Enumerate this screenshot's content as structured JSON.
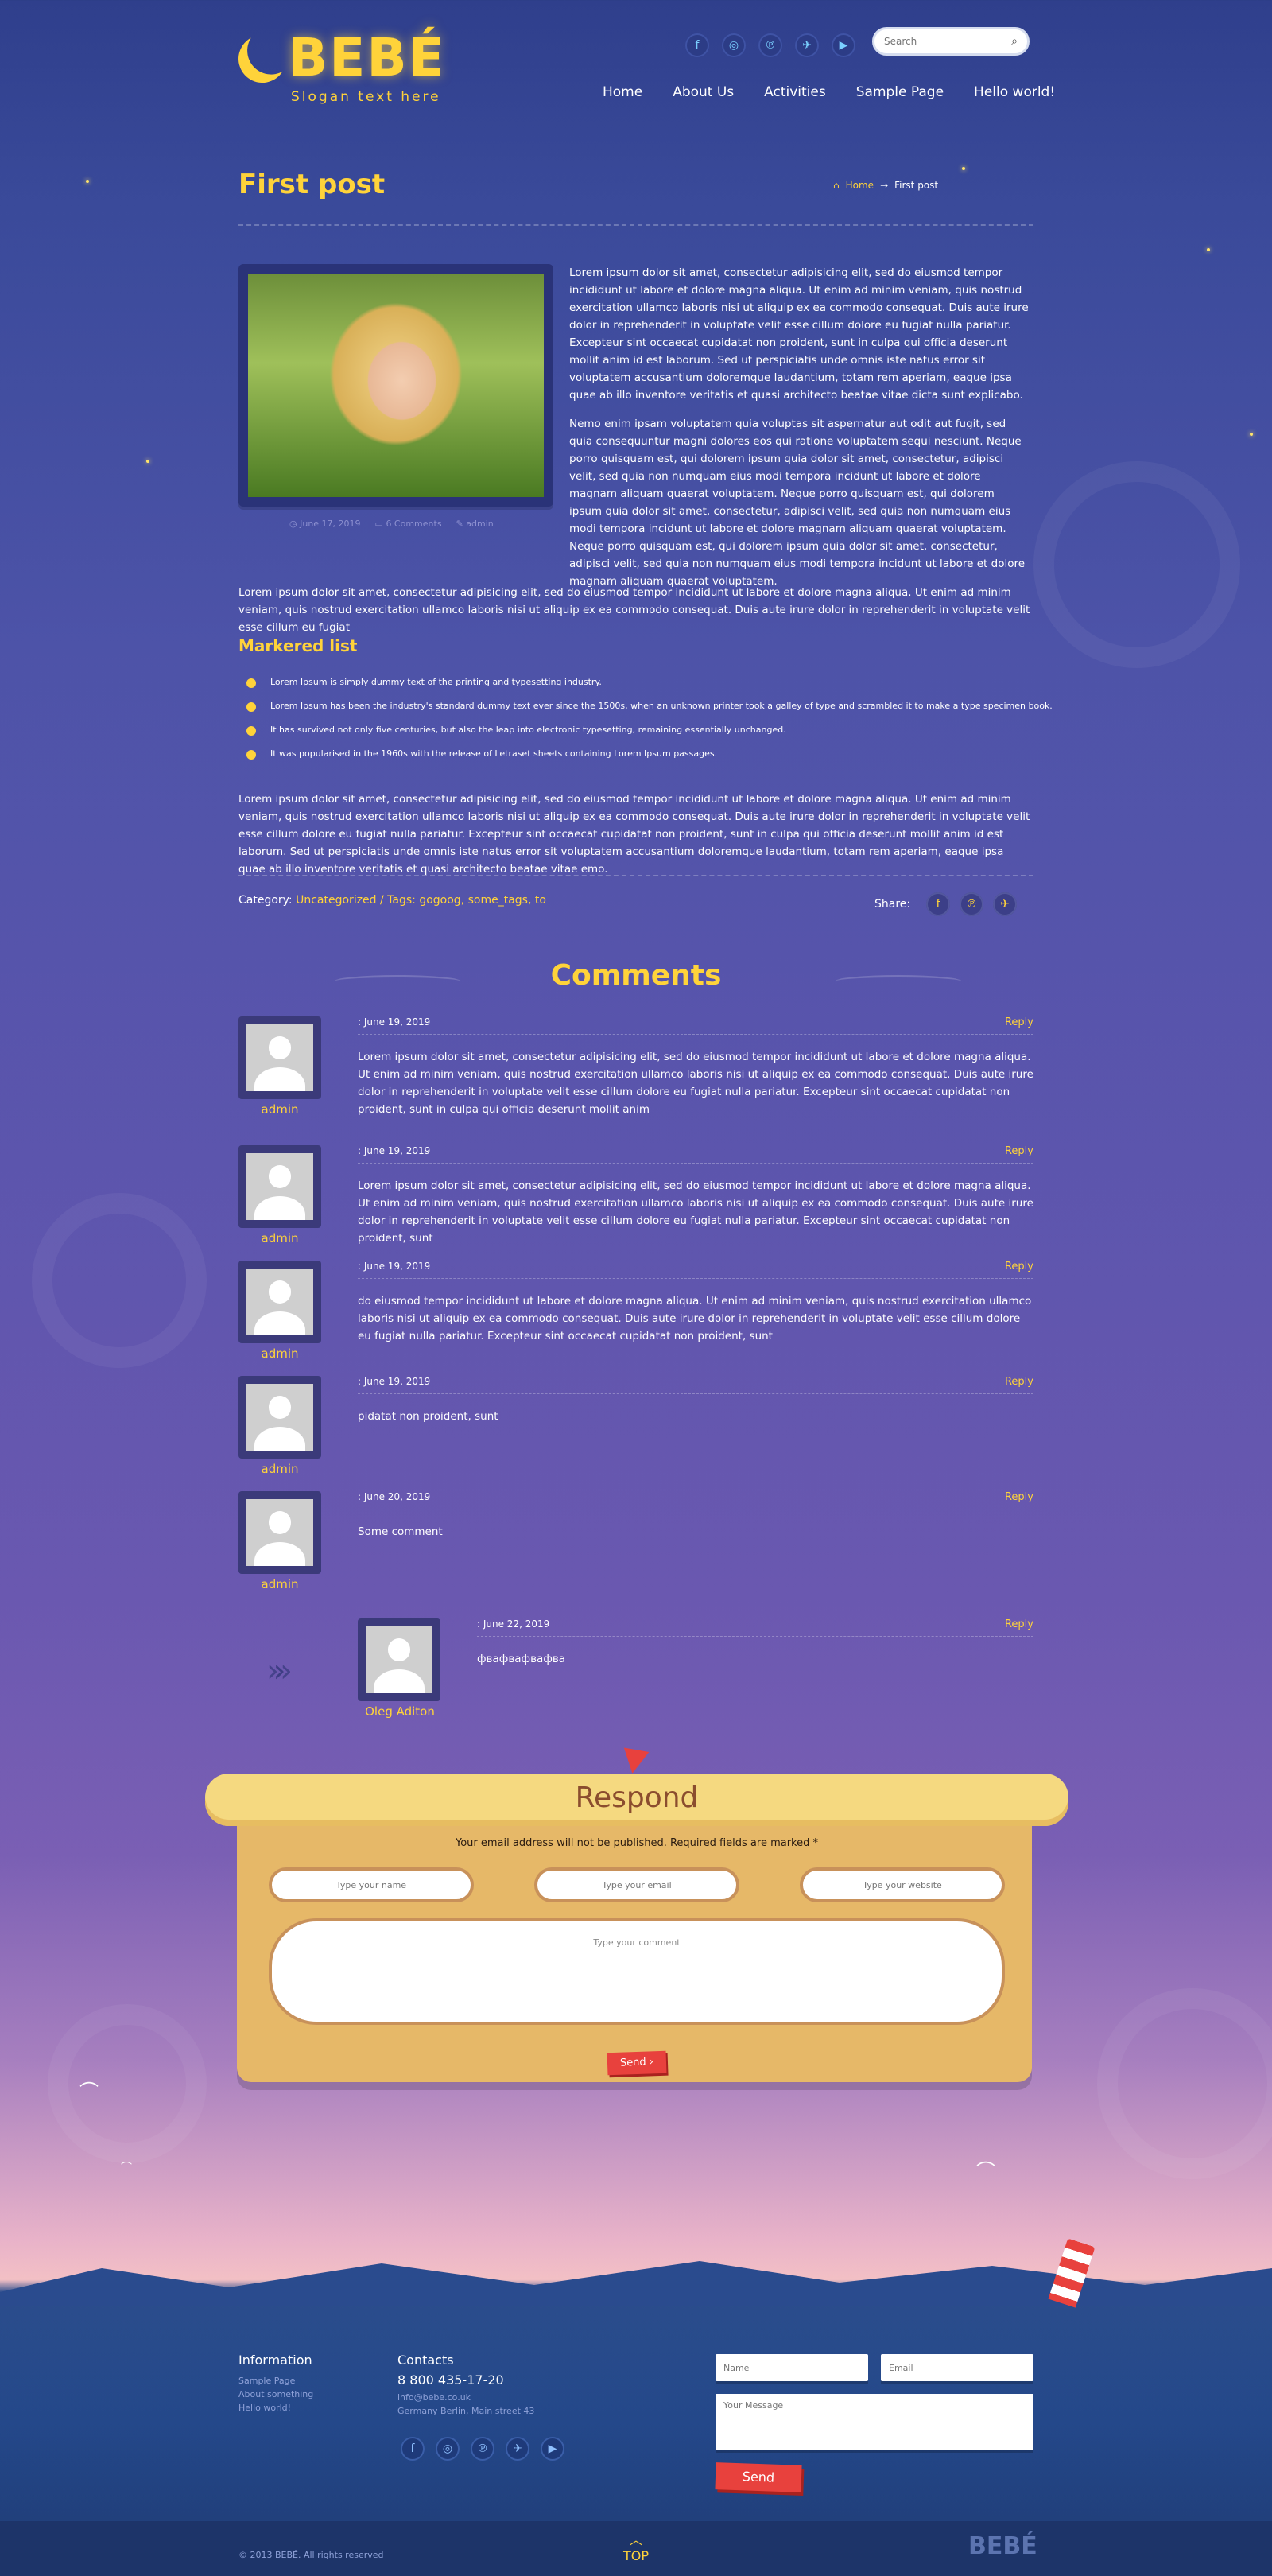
{
  "header": {
    "logo_text": "BEBÉ",
    "slogan": "Slogan text here",
    "social": [
      {
        "icon": "facebook-icon",
        "glyph": "f"
      },
      {
        "icon": "instagram-icon",
        "glyph": "◎"
      },
      {
        "icon": "pinterest-icon",
        "glyph": "℗"
      },
      {
        "icon": "twitter-icon",
        "glyph": "✈"
      },
      {
        "icon": "youtube-icon",
        "glyph": "▶"
      }
    ],
    "search_placeholder": "Search",
    "nav": [
      "Home",
      "About Us",
      "Activities",
      "Sample Page",
      "Hello world!"
    ]
  },
  "page": {
    "title": "First post",
    "breadcrumb_home": "Home",
    "breadcrumb_sep": "→",
    "breadcrumb_current": "First post"
  },
  "post": {
    "meta_date": "June 17, 2019",
    "meta_comments": "6 Comments",
    "meta_author": "admin",
    "p1": "Lorem ipsum dolor sit amet, consectetur adipisicing elit, sed do eiusmod tempor incididunt ut labore et dolore magna aliqua. Ut enim ad minim veniam, quis nostrud exercitation ullamco laboris nisi ut aliquip ex ea commodo consequat. Duis aute irure dolor in reprehenderit in voluptate velit esse cillum dolore eu fugiat nulla pariatur. Excepteur sint occaecat cupidatat non proident, sunt in culpa qui officia deserunt mollit anim id est laborum. Sed ut perspiciatis unde omnis iste natus error sit voluptatem accusantium doloremque laudantium, totam rem aperiam, eaque ipsa quae ab illo inventore veritatis et quasi architecto beatae vitae dicta sunt explicabo.",
    "p2": "Nemo enim ipsam voluptatem quia voluptas sit aspernatur aut odit aut fugit, sed quia consequuntur magni dolores eos qui ratione voluptatem sequi nesciunt. Neque porro quisquam est, qui dolorem ipsum quia dolor sit amet, consectetur, adipisci velit, sed quia non numquam eius modi tempora incidunt ut labore et dolore magnam aliquam quaerat voluptatem. Neque porro quisquam est, qui dolorem ipsum quia dolor sit amet, consectetur, adipisci velit, sed quia non numquam eius modi tempora incidunt ut labore et dolore magnam aliquam quaerat voluptatem. Neque porro quisquam est, qui dolorem ipsum quia dolor sit amet, consectetur, adipisci velit, sed quia non numquam eius modi tempora incidunt ut labore et dolore magnam aliquam quaerat voluptatem.",
    "p3": "Lorem ipsum dolor sit amet, consectetur adipisicing elit, sed do eiusmod tempor incididunt ut labore et dolore magna aliqua. Ut enim ad minim veniam, quis nostrud exercitation ullamco laboris nisi ut aliquip ex ea commodo consequat. Duis aute irure dolor in reprehenderit in voluptate velit esse cillum eu fugiat",
    "list_title": "Markered list",
    "list": [
      "Lorem Ipsum is simply dummy text of the printing and typesetting industry.",
      "Lorem Ipsum has been the industry's standard dummy text ever since the 1500s, when an unknown printer took a galley of type and scrambled it to make a type specimen book.",
      "It has survived not only five centuries, but also the leap into electronic typesetting, remaining essentially unchanged.",
      "It was popularised in the 1960s with the release of Letraset sheets containing Lorem Ipsum passages."
    ],
    "p4": "Lorem ipsum dolor sit amet, consectetur adipisicing elit, sed do eiusmod tempor incididunt ut labore et dolore magna aliqua. Ut enim ad minim veniam, quis nostrud exercitation ullamco laboris nisi ut aliquip ex ea commodo consequat. Duis aute irure dolor in reprehenderit in voluptate velit esse cillum dolore eu fugiat nulla pariatur. Excepteur sint occaecat cupidatat non proident, sunt in culpa qui officia deserunt mollit anim id est laborum. Sed ut perspiciatis unde omnis iste natus error sit voluptatem accusantium doloremque laudantium, totam rem aperiam, eaque ipsa quae ab illo inventore veritatis et quasi architecto beatae vitae emo.",
    "category_label": "Category:",
    "category_value": "Uncategorized / Tags: gogoog, some_tags, to",
    "share_label": "Share:",
    "share_icons": [
      {
        "icon": "facebook-icon",
        "glyph": "f"
      },
      {
        "icon": "pinterest-icon",
        "glyph": "℗"
      },
      {
        "icon": "twitter-icon",
        "glyph": "✈"
      }
    ]
  },
  "comments": {
    "title": "Comments",
    "reply_label": "Reply",
    "items": [
      {
        "author": "admin",
        "date": ": June 19, 2019",
        "text": "Lorem ipsum dolor sit amet, consectetur adipisicing elit, sed do eiusmod tempor incididunt ut labore et dolore magna aliqua. Ut enim ad minim veniam, quis nostrud exercitation ullamco laboris nisi ut aliquip ex ea commodo consequat. Duis aute irure dolor in reprehenderit in voluptate velit esse cillum dolore eu fugiat nulla pariatur. Excepteur sint occaecat cupidatat non proident, sunt in culpa qui officia deserunt mollit anim"
      },
      {
        "author": "admin",
        "date": ": June 19, 2019",
        "text": "Lorem ipsum dolor sit amet, consectetur adipisicing elit, sed do eiusmod tempor incididunt ut labore et dolore magna aliqua. Ut enim ad minim veniam, quis nostrud exercitation ullamco laboris nisi ut aliquip ex ea commodo consequat. Duis aute irure dolor in reprehenderit in voluptate velit esse cillum dolore eu fugiat nulla pariatur. Excepteur sint occaecat cupidatat non proident, sunt"
      },
      {
        "author": "admin",
        "date": ": June 19, 2019",
        "text": "do eiusmod tempor incididunt ut labore et dolore magna aliqua. Ut enim ad minim veniam, quis nostrud exercitation ullamco laboris nisi ut aliquip ex ea commodo consequat. Duis aute irure dolor in reprehenderit in voluptate velit esse cillum dolore eu fugiat nulla pariatur. Excepteur sint occaecat cupidatat non proident, sunt"
      },
      {
        "author": "admin",
        "date": ": June 19, 2019",
        "text": "pidatat non proident, sunt"
      },
      {
        "author": "admin",
        "date": ": June 20, 2019",
        "text": "Some comment"
      },
      {
        "author": "Oleg Aditon",
        "date": ": June 22, 2019",
        "text": "фвафвафвафва"
      }
    ]
  },
  "respond": {
    "title": "Respond",
    "note": "Your email address will not be published. Required fields are marked *",
    "name_placeholder": "Type your name",
    "email_placeholder": "Type your email",
    "website_placeholder": "Type your website",
    "comment_placeholder": "Type your comment",
    "send_label": "Send ›"
  },
  "footer": {
    "info_title": "Information",
    "info_links": [
      "Sample Page",
      "About something",
      "Hello world!"
    ],
    "contacts_title": "Contacts",
    "phone": "8 800 435-17-20",
    "email": "info@bebe.co.uk",
    "address": "Germany Berlin, Main street 43",
    "social": [
      {
        "icon": "facebook-icon",
        "glyph": "f"
      },
      {
        "icon": "instagram-icon",
        "glyph": "◎"
      },
      {
        "icon": "pinterest-icon",
        "glyph": "℗"
      },
      {
        "icon": "twitter-icon",
        "glyph": "✈"
      },
      {
        "icon": "youtube-icon",
        "glyph": "▶"
      }
    ],
    "form_name_placeholder": "Name",
    "form_email_placeholder": "Email",
    "form_message_placeholder": "Your Message",
    "form_send_label": "Send",
    "copyright": "© 2013 BEBÉ. All rights reserved",
    "top_label": "TOP",
    "logo_text": "BEBÉ"
  },
  "colors": {
    "accent_yellow": "#ffd33a",
    "accent_red": "#e8413d",
    "respond_board": "#e6b868"
  }
}
